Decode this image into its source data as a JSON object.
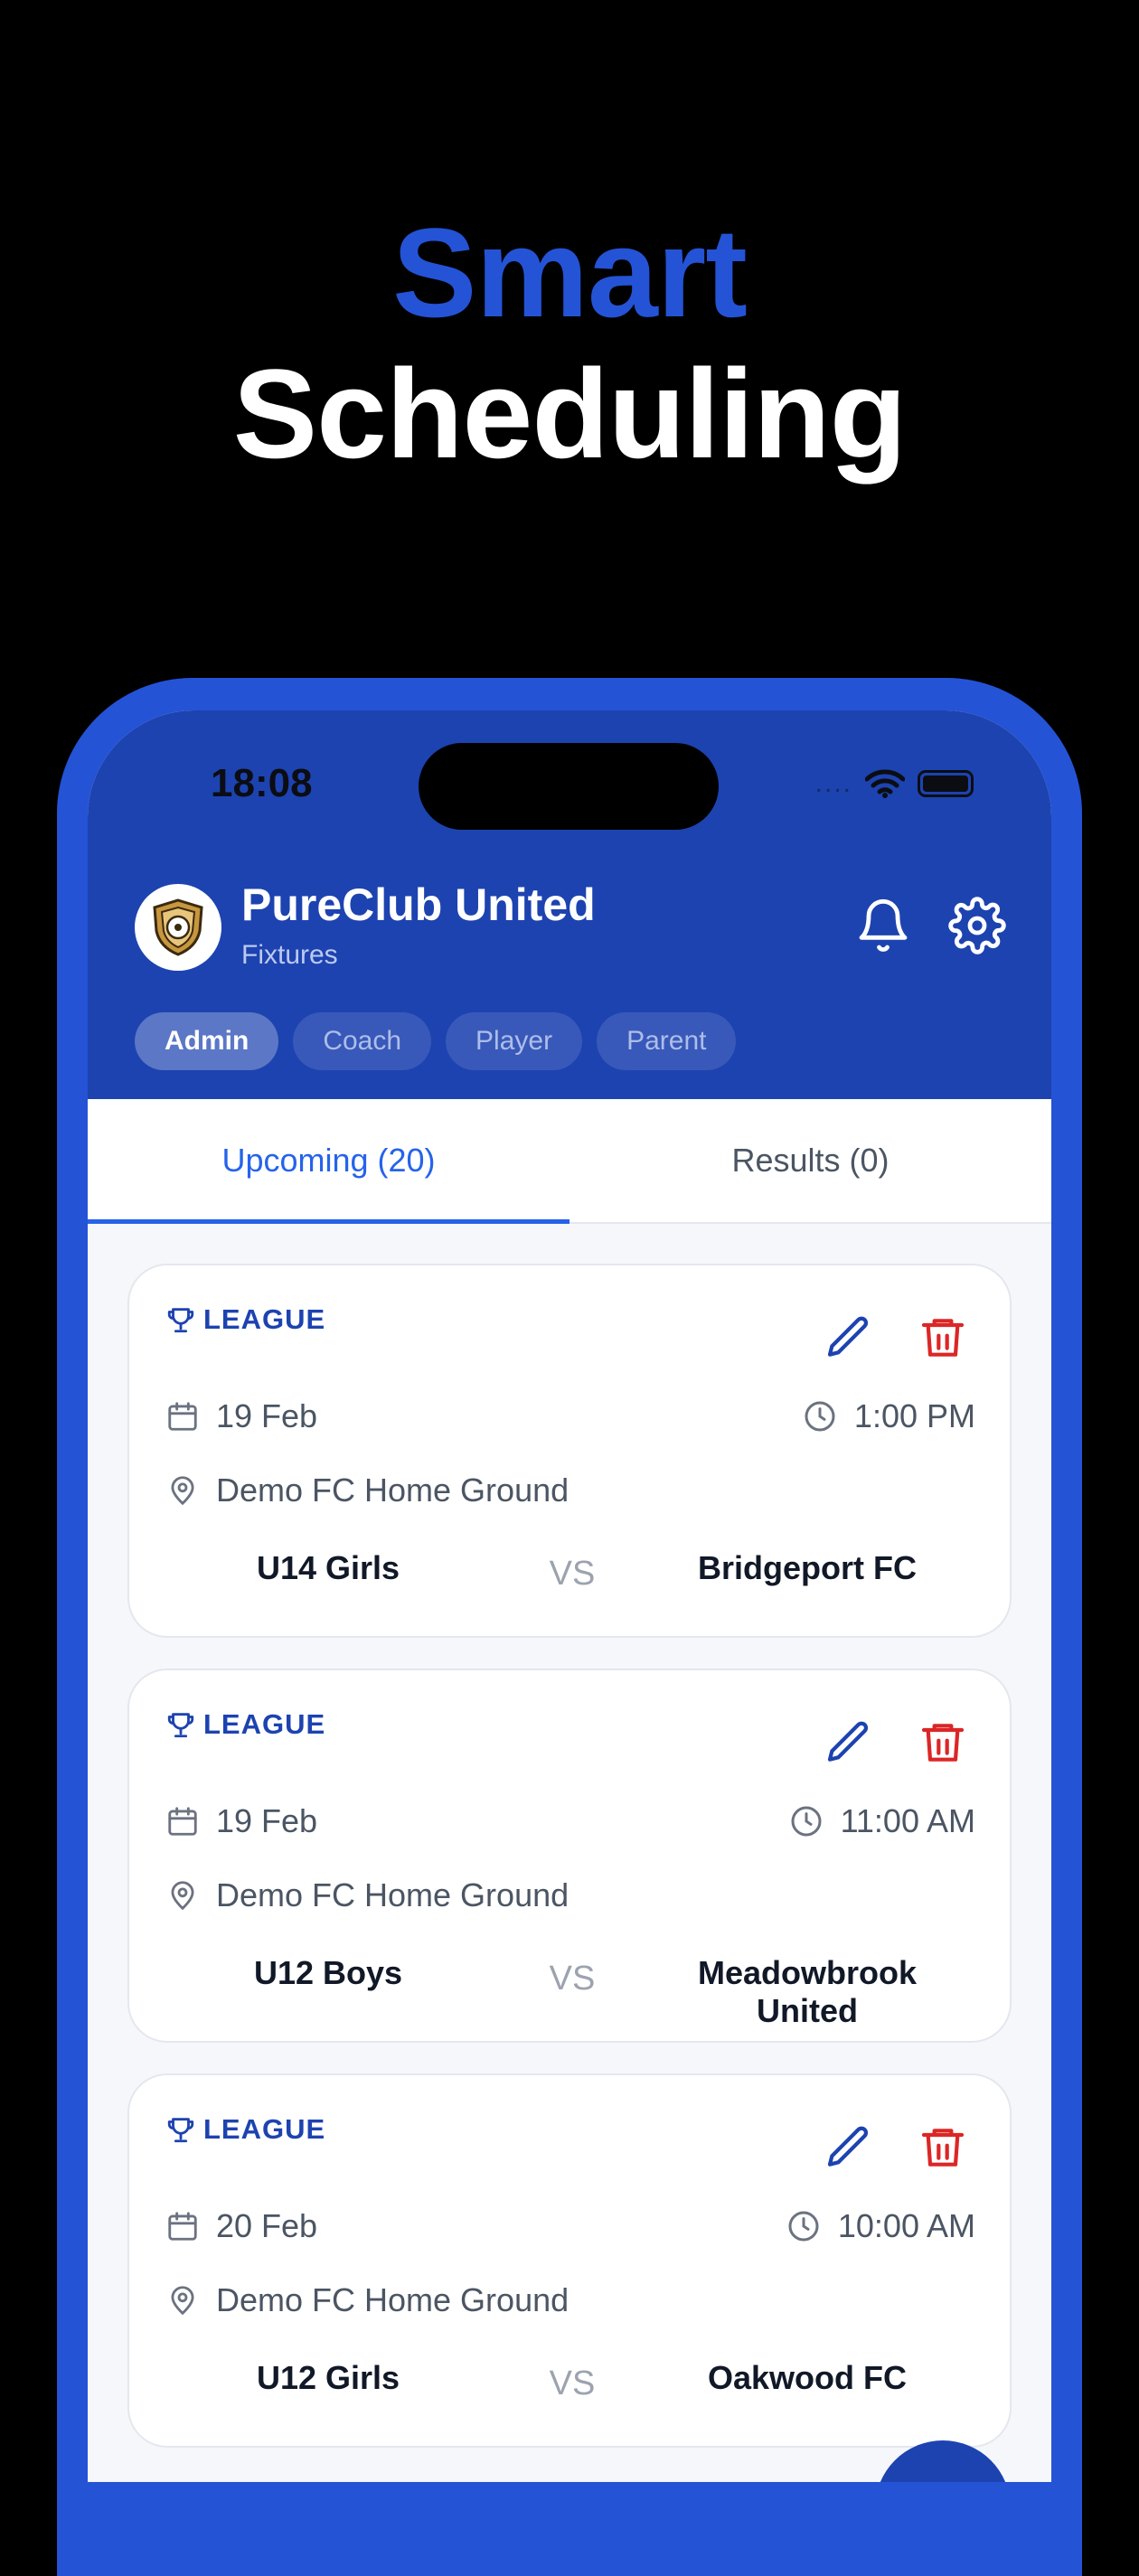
{
  "hero": {
    "line1": "Smart",
    "line2": "Scheduling"
  },
  "status_bar": {
    "time": "18:08",
    "signal": "....",
    "icons": [
      "wifi-icon",
      "battery-icon"
    ]
  },
  "header": {
    "club_name": "PureClub United",
    "section": "Fixtures",
    "logo_icon": "club-crest-icon",
    "actions": [
      "bell-icon",
      "gear-icon"
    ],
    "roles": [
      "Admin",
      "Coach",
      "Player",
      "Parent"
    ],
    "active_role": "Admin"
  },
  "tabs": [
    {
      "label": "Upcoming (20)",
      "active": true
    },
    {
      "label": "Results (0)",
      "active": false
    }
  ],
  "fixtures": [
    {
      "type": "LEAGUE",
      "date": "19 Feb",
      "time": "1:00 PM",
      "venue": "Demo FC Home Ground",
      "home": "U14 Girls",
      "vs": "VS",
      "away": "Bridgeport FC"
    },
    {
      "type": "LEAGUE",
      "date": "19 Feb",
      "time": "11:00 AM",
      "venue": "Demo FC Home Ground",
      "home": "U12 Boys",
      "vs": "VS",
      "away": "Meadowbrook United"
    },
    {
      "type": "LEAGUE",
      "date": "20 Feb",
      "time": "10:00 AM",
      "venue": "Demo FC Home Ground",
      "home": "U12 Girls",
      "vs": "VS",
      "away": "Oakwood FC"
    }
  ],
  "colors": {
    "accent": "#2453d6",
    "header_bg": "#1d43b0",
    "delete": "#dc2626",
    "tab_active": "#2563eb"
  }
}
